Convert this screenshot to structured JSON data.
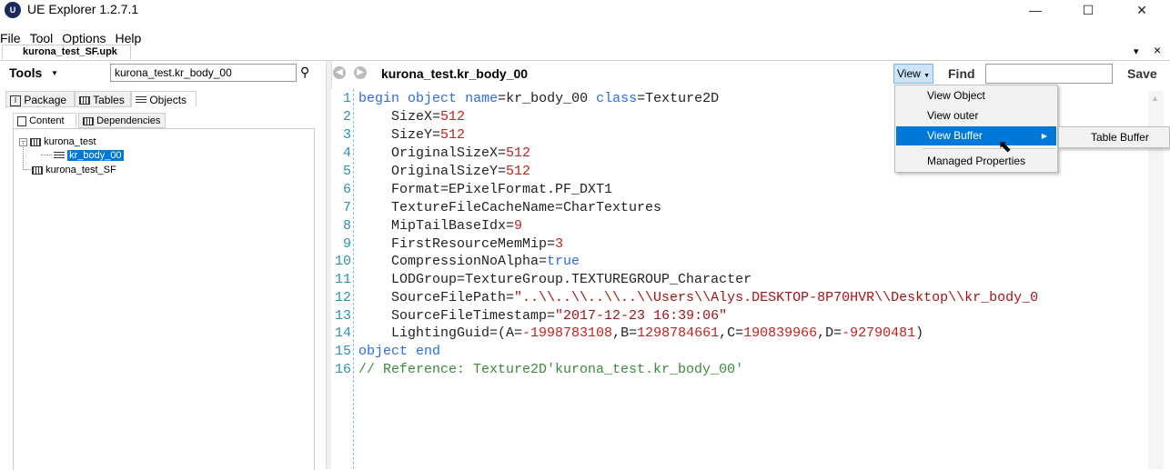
{
  "window": {
    "title": "UE Explorer 1.2.7.1",
    "icon_text": "U",
    "minimize": "—",
    "maximize": "☐",
    "close": "✕"
  },
  "menubar": {
    "items": [
      "File",
      "Tool",
      "Options",
      "Help"
    ]
  },
  "document_tab": {
    "label": "kurona_test_SF.upk",
    "pin": "▾",
    "close": "×"
  },
  "left_panel": {
    "tools_label": "Tools",
    "search_value": "kurona_test.kr_body_00",
    "tabs": [
      "Package",
      "Tables",
      "Objects"
    ],
    "subtabs": [
      "Content",
      "Dependencies"
    ],
    "tree": {
      "root1": "kurona_test",
      "child1": "kr_body_00",
      "root2": "kurona_test_SF"
    }
  },
  "right_panel": {
    "object_title": "kurona_test.kr_body_00",
    "view_label": "View",
    "find_label": "Find",
    "find_value": "",
    "save_label": "Save"
  },
  "view_menu": {
    "items": [
      "View Object",
      "View outer",
      "View Buffer",
      "Managed Properties"
    ],
    "submenu_item": "Table Buffer"
  },
  "code": {
    "line_numbers": [
      "1",
      "2",
      "3",
      "4",
      "5",
      "6",
      "7",
      "8",
      "9",
      "10",
      "11",
      "12",
      "13",
      "14",
      "15",
      "16"
    ],
    "lines": {
      "l1": {
        "kw1": "begin",
        "kw2": "object",
        "a": "name",
        "b": "=kr_body_00 ",
        "kw3": "class",
        "c": "=Texture2D"
      },
      "l2": {
        "a": "    SizeX=",
        "n": "512"
      },
      "l3": {
        "a": "    SizeY=",
        "n": "512"
      },
      "l4": {
        "a": "    OriginalSizeX=",
        "n": "512"
      },
      "l5": {
        "a": "    OriginalSizeY=",
        "n": "512"
      },
      "l6": {
        "a": "    Format=EPixelFormat.PF_DXT1"
      },
      "l7": {
        "a": "    TextureFileCacheName=CharTextures"
      },
      "l8": {
        "a": "    MipTailBaseIdx=",
        "n": "9"
      },
      "l9": {
        "a": "    FirstResourceMemMip=",
        "n": "3"
      },
      "l10": {
        "a": "    CompressionNoAlpha=",
        "kw": "true"
      },
      "l11": {
        "a": "    LODGroup=TextureGroup.TEXTUREGROUP_Character"
      },
      "l12": {
        "a": "    SourceFilePath=",
        "s": "\"..\\\\..\\\\..\\\\..\\\\Users\\\\Alys.DESKTOP-8P70HVR\\\\Desktop\\\\kr_body_0"
      },
      "l13": {
        "a": "    SourceFileTimestamp=",
        "s": "\"2017-12-23 16:39:06\""
      },
      "l14": {
        "a": "    LightingGuid=(A=",
        "n1": "-1998783108",
        "b": ",B=",
        "n2": "1298784661",
        "c": ",C=",
        "n3": "190839966",
        "d": ",D=",
        "n4": "-92790481",
        "e": ")"
      },
      "l15": {
        "kw1": "object",
        "sp": " ",
        "kw2": "end"
      },
      "l16": {
        "c": "// Reference: Texture2D'kurona_test.kr_body_00'"
      }
    }
  }
}
